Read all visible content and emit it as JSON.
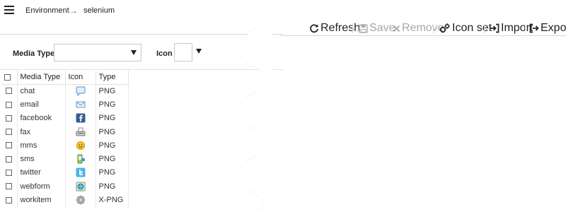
{
  "breadcrumb": {
    "parent": "Environment",
    "current": "selenium"
  },
  "toolbar": {
    "refresh": "Refresh",
    "save": "Save",
    "remove": "Remove",
    "icon_set": "Icon set",
    "import": "Import",
    "export": "Export"
  },
  "filters": {
    "media_type_label": "Media Type",
    "media_type_value": "",
    "icon_label": "Icon"
  },
  "table": {
    "headers": {
      "media_type": "Media Type",
      "icon": "Icon",
      "type": "Type"
    },
    "rows": [
      {
        "media_type": "chat",
        "icon": "chat-bubble-icon",
        "type": "PNG"
      },
      {
        "media_type": "email",
        "icon": "envelope-icon",
        "type": "PNG"
      },
      {
        "media_type": "facebook",
        "icon": "facebook-icon",
        "type": "PNG"
      },
      {
        "media_type": "fax",
        "icon": "fax-icon",
        "type": "PNG"
      },
      {
        "media_type": "mms",
        "icon": "mms-smiley-icon",
        "type": "PNG"
      },
      {
        "media_type": "sms",
        "icon": "sms-phone-icon",
        "type": "PNG"
      },
      {
        "media_type": "twitter",
        "icon": "twitter-icon",
        "type": "PNG"
      },
      {
        "media_type": "webform",
        "icon": "webform-icon",
        "type": "PNG"
      },
      {
        "media_type": "workitem",
        "icon": "gear-icon",
        "type": "X-PNG"
      }
    ]
  },
  "colors": {
    "accent_blue": "#3b5998",
    "twitter_blue": "#4ab3e8",
    "disabled_text": "#a8a8a8"
  }
}
